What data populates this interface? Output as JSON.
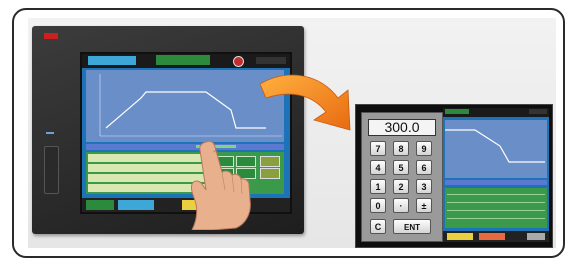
{
  "illustration": {
    "panel": {
      "screen": {
        "foot_labels": []
      }
    },
    "keypad": {
      "display_value": "300.0",
      "keys": [
        [
          "7",
          "8",
          "9"
        ],
        [
          "4",
          "5",
          "6"
        ],
        [
          "1",
          "2",
          "3"
        ],
        [
          "0",
          "·",
          "±"
        ],
        [
          "C",
          "ENT"
        ]
      ]
    },
    "colors": {
      "screen_blue": "#1d73b8",
      "graph_bg": "#6a8ec8",
      "panel_dark": "#2a2a2a",
      "arrow_orange": "#f08a1a",
      "grid_green": "#3a9a4a"
    },
    "icons": [
      "hand-pointer-icon",
      "curved-arrow-icon"
    ]
  }
}
